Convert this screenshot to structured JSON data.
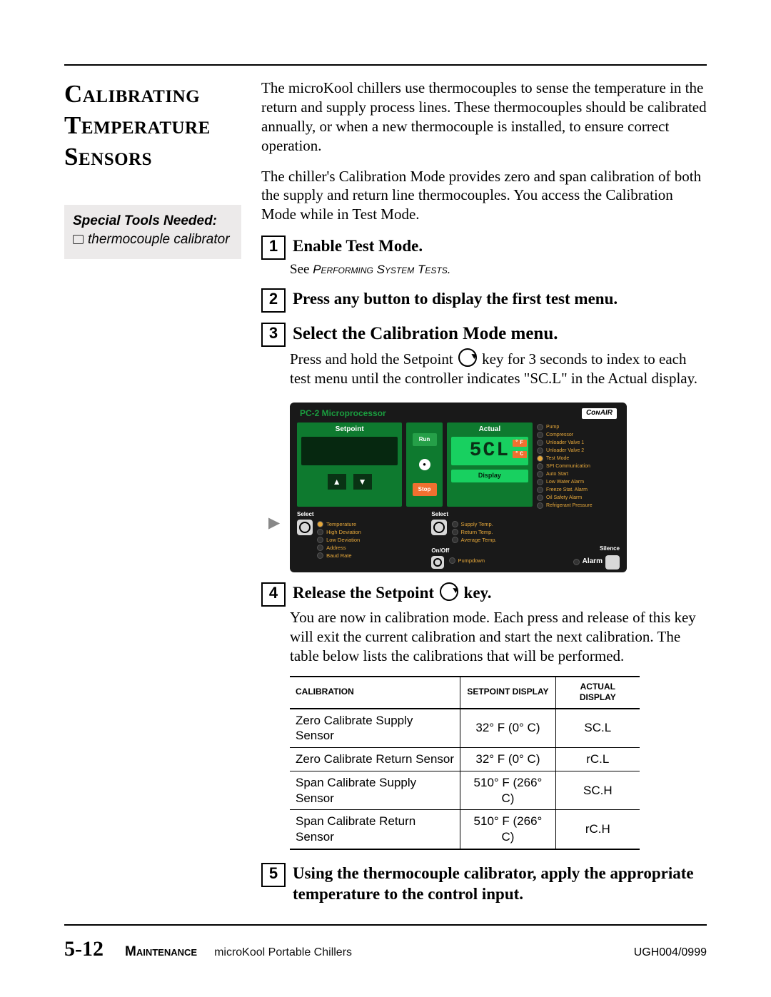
{
  "header": {
    "title_line1": "Calibrating",
    "title_line2": "Temperature",
    "title_line3": "Sensors"
  },
  "tools": {
    "heading": "Special Tools Needed:",
    "item1": "thermocouple calibrator"
  },
  "intro": {
    "p1": "The microKool chillers use thermocouples to sense the temperature in the return and supply process lines. These thermocouples should be calibrated annually, or when a new thermocouple is installed, to ensure correct operation.",
    "p2": "The chiller's Calibration Mode provides zero and span calibration of both the supply and return line thermocouples. You access the Calibration Mode while in Test Mode."
  },
  "steps": {
    "s1": {
      "num": "1",
      "title": "Enable Test Mode.",
      "sub_prefix": "See ",
      "sub_cap": "Performing System Tests.",
      "sub_suffix": ""
    },
    "s2": {
      "num": "2",
      "title": "Press any button to display the first test menu."
    },
    "s3": {
      "num": "3",
      "title": "Select the Calibration Mode menu.",
      "desc_a": "Press and hold the Setpoint ",
      "desc_b": " key for 3 seconds to index to each test menu until the controller indicates \"SC.L\" in the Actual display."
    },
    "s4": {
      "num": "4",
      "title_a": "Release the Setpoint ",
      "title_b": " key.",
      "desc": "You are now in calibration mode. Each press and release of this key will exit the current calibration and start the next calibration. The table below lists the calibrations that will be performed."
    },
    "s5": {
      "num": "5",
      "title": "Using the thermocouple calibrator, apply the appropriate temperature to the control input."
    }
  },
  "panel": {
    "title": "PC-2 Microprocessor",
    "brand": "CᴏɴAIR",
    "setpoint": "Setpoint",
    "actual": "Actual",
    "actual_value": "5CL",
    "unit_f": "°F",
    "unit_c": "°C",
    "run": "Run",
    "stop": "Stop",
    "display": "Display",
    "status": [
      "Pump",
      "Compressor",
      "Unloader Valve 1",
      "Unloader Valve 2",
      "Test Mode",
      "SPI Communication",
      "Auto Start",
      "Low Water Alarm",
      "Freeze Stat. Alarm",
      "Oil Safety Alarm",
      "Refrigerant Pressure"
    ],
    "left_select": "Select",
    "left_items": [
      "Temperature",
      "High Deviation",
      "Low Deviation",
      "Address",
      "Baud Rate"
    ],
    "mid_select": "Select",
    "mid_items": [
      "Supply Temp.",
      "Return Temp.",
      "Average Temp."
    ],
    "onoff": "On/Off",
    "pumpdown": "Pumpdown",
    "silence": "Silence",
    "alarm": "Alarm"
  },
  "table": {
    "h1": "Calibration",
    "h2": "Setpoint Display",
    "h3": "Actual Display",
    "rows": [
      {
        "c1": "Zero Calibrate Supply Sensor",
        "c2": "32° F (0° C)",
        "c3": "SC.L"
      },
      {
        "c1": "Zero Calibrate Return Sensor",
        "c2": "32° F (0° C)",
        "c3": "rC.L"
      },
      {
        "c1": "Span Calibrate Supply Sensor",
        "c2": "510° F (266° C)",
        "c3": "SC.H"
      },
      {
        "c1": "Span Calibrate Return Sensor",
        "c2": "510° F (266° C)",
        "c3": "rC.H"
      }
    ]
  },
  "footer": {
    "page": "5-12",
    "section": "Maintenance",
    "doc": "microKool Portable Chillers",
    "code": "UGH004/0999"
  }
}
